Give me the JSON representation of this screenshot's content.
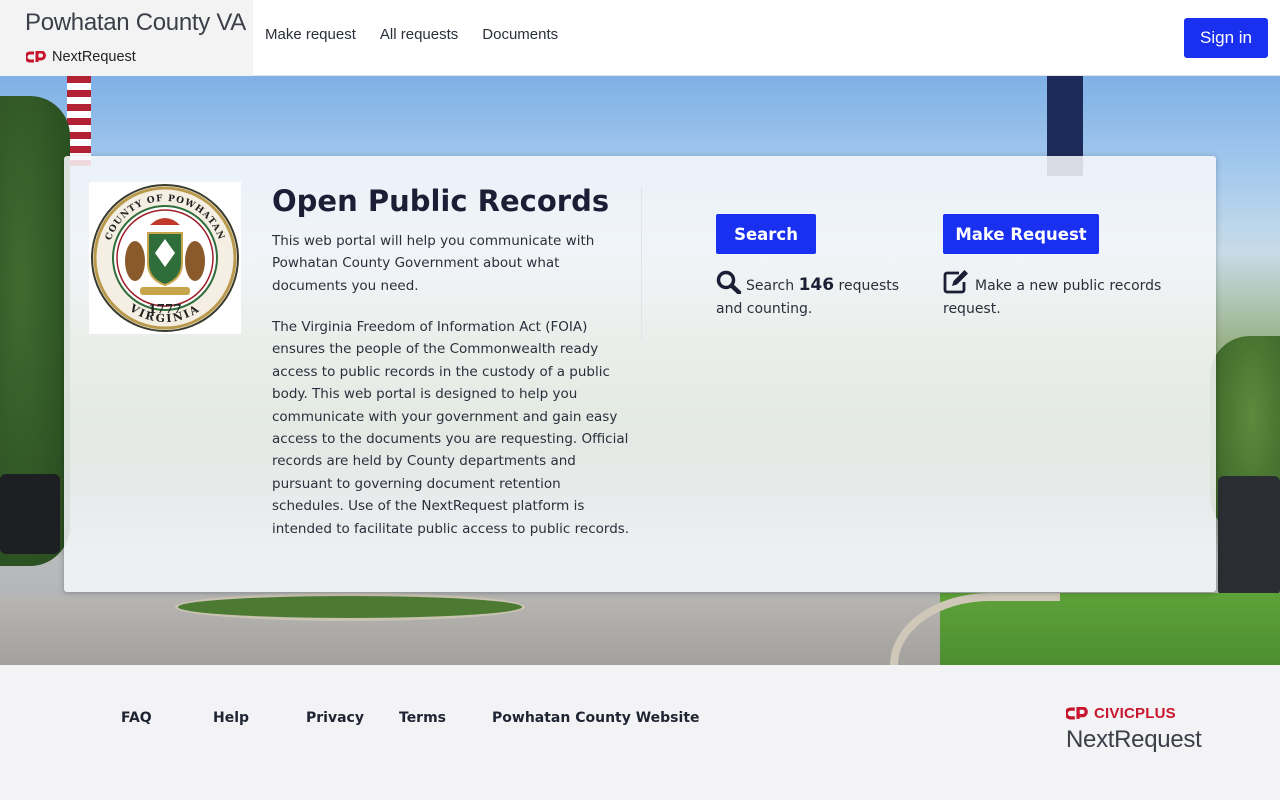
{
  "header": {
    "org_name": "Powhatan County VA",
    "product_name": "NextRequest",
    "nav": [
      "Make request",
      "All requests",
      "Documents"
    ],
    "signin_label": "Sign in"
  },
  "hero": {
    "seal": {
      "top_text": "COUNTY OF POWHATAN",
      "year": "1777",
      "bottom_text": "VIRGINIA"
    },
    "title": "Open Public Records",
    "intro": "This web portal will help you communicate with Powhatan County Government about what documents you need.",
    "foia": "The Virginia Freedom of Information Act (FOIA) ensures the people of the Commonwealth ready access to public records in the custody of a public body. This web portal is designed to help you communicate with your government and gain easy access to the documents you are requesting. Official records are held by County departments and pursuant to governing document retention schedules. Use of the NextRequest platform is intended to facilitate public access to public records.",
    "search": {
      "button_label": "Search",
      "text_before": "Search",
      "count": "146",
      "text_after": "requests and counting.",
      "icon": "search-icon"
    },
    "make_request": {
      "button_label": "Make Request",
      "text": "Make a new public records request.",
      "icon": "edit-icon"
    }
  },
  "footer": {
    "links": [
      "FAQ",
      "Help",
      "Privacy",
      "Terms",
      "Powhatan County Website"
    ],
    "civicplus_label": "CIVICPLUS",
    "product_label": "NextRequest"
  },
  "colors": {
    "primary": "#1a30f0",
    "brand_red": "#c8142c",
    "text_dark": "#1a1f36"
  }
}
